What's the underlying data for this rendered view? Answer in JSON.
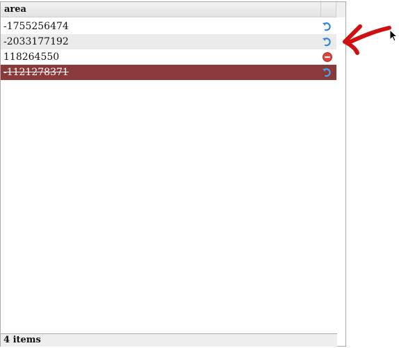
{
  "grid": {
    "column_header": "area",
    "rows": [
      {
        "value": "-1755256474",
        "state": "normal",
        "action_icon": "undo-icon"
      },
      {
        "value": "-2033177192",
        "state": "alt",
        "action_icon": "undo-icon"
      },
      {
        "value": "118264550",
        "state": "normal",
        "action_icon": "delete-icon"
      },
      {
        "value": "-1121278371",
        "state": "deleted",
        "action_icon": "undo-icon"
      }
    ],
    "footer_text": "4 items"
  },
  "colors": {
    "deleted_row": "#8b3a3a",
    "alt_row": "#ebebeb",
    "annotation_arrow": "#d01010",
    "undo_icon": "#2e86d6",
    "delete_icon": "#e0413a"
  }
}
